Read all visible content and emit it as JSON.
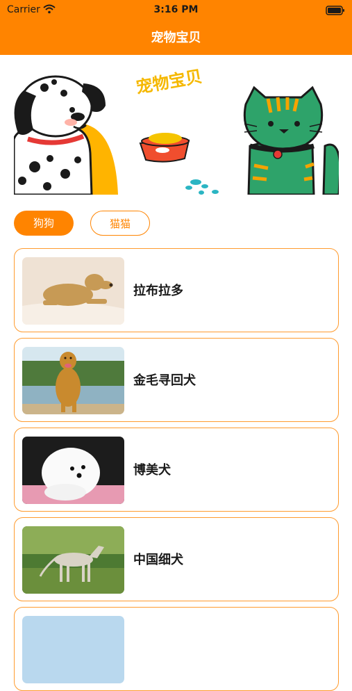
{
  "status_bar": {
    "carrier": "Carrier",
    "time": "3:16 PM"
  },
  "nav": {
    "title": "宠物宝贝"
  },
  "banner": {
    "title": "宠物宝贝"
  },
  "tabs": [
    {
      "label": "狗狗",
      "active": true
    },
    {
      "label": "猫猫",
      "active": false
    }
  ],
  "pets": [
    {
      "name": "拉布拉多"
    },
    {
      "name": "金毛寻回犬"
    },
    {
      "name": "博美犬"
    },
    {
      "name": "中国细犬"
    },
    {
      "name": ""
    }
  ],
  "colors": {
    "accent": "#ff8400",
    "card_border": "#ff9b2e",
    "banner_title": "#f5b800"
  }
}
